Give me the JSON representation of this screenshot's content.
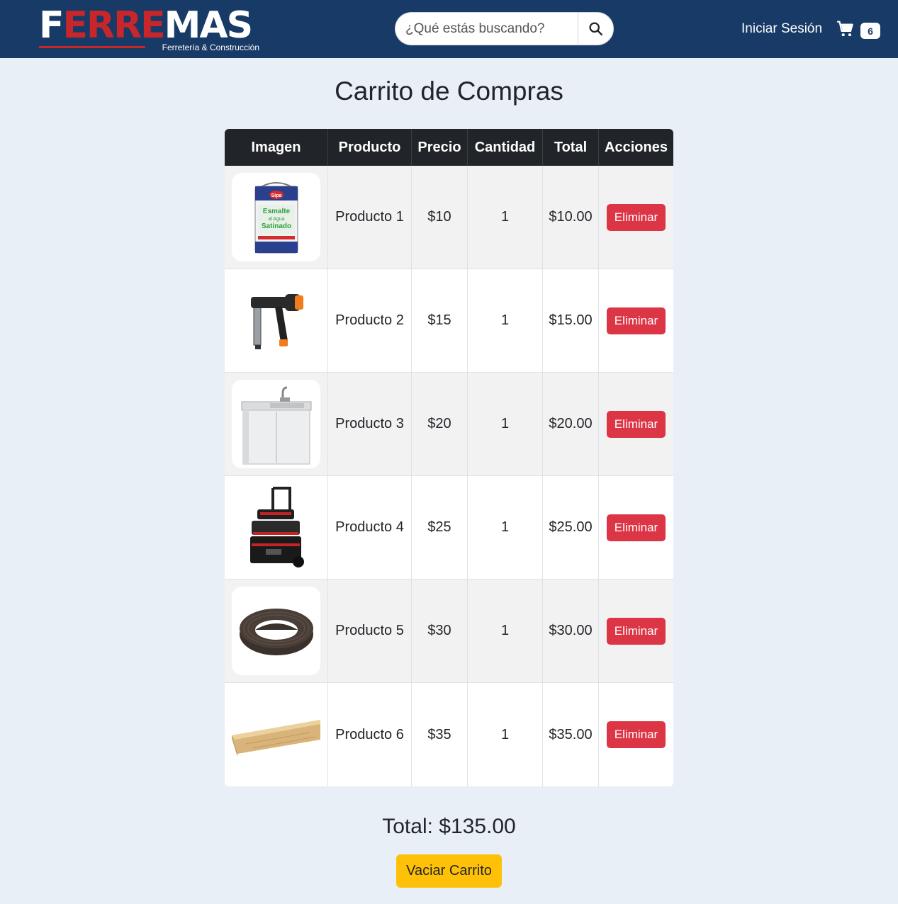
{
  "brand": {
    "logo_word_parts": [
      "F",
      "ERRE",
      "MAS"
    ],
    "tagline": "Ferretería & Construcción",
    "nav_color": "#173a66",
    "accent_red": "#c8262b"
  },
  "header": {
    "search_placeholder": "¿Qué estás buscando?",
    "search_icon": "search-icon",
    "login_label": "Iniciar Sesión",
    "cart_icon": "cart-icon",
    "cart_count": "6"
  },
  "page": {
    "title": "Carrito de Compras"
  },
  "table": {
    "headers": [
      "Imagen",
      "Producto",
      "Precio",
      "Cantidad",
      "Total",
      "Acciones"
    ],
    "rows": [
      {
        "image": "paint-can-image",
        "product": "Producto 1",
        "price": "$10",
        "qty": "1",
        "total": "$10.00",
        "action": "Eliminar"
      },
      {
        "image": "nail-gun-image",
        "product": "Producto 2",
        "price": "$15",
        "qty": "1",
        "total": "$15.00",
        "action": "Eliminar"
      },
      {
        "image": "sink-cabinet-image",
        "product": "Producto 3",
        "price": "$20",
        "qty": "1",
        "total": "$20.00",
        "action": "Eliminar"
      },
      {
        "image": "toolbox-cart-image",
        "product": "Producto 4",
        "price": "$25",
        "qty": "1",
        "total": "$25.00",
        "action": "Eliminar"
      },
      {
        "image": "edge-band-roll-image",
        "product": "Producto 5",
        "price": "$30",
        "qty": "1",
        "total": "$30.00",
        "action": "Eliminar"
      },
      {
        "image": "wood-board-image",
        "product": "Producto 6",
        "price": "$35",
        "qty": "1",
        "total": "$35.00",
        "action": "Eliminar"
      }
    ]
  },
  "summary": {
    "total_label": "Total: $135.00",
    "empty_button": "Vaciar Carrito"
  },
  "colors": {
    "delete": "#dc3545",
    "empty": "#ffc107",
    "header_dark": "#212529"
  }
}
